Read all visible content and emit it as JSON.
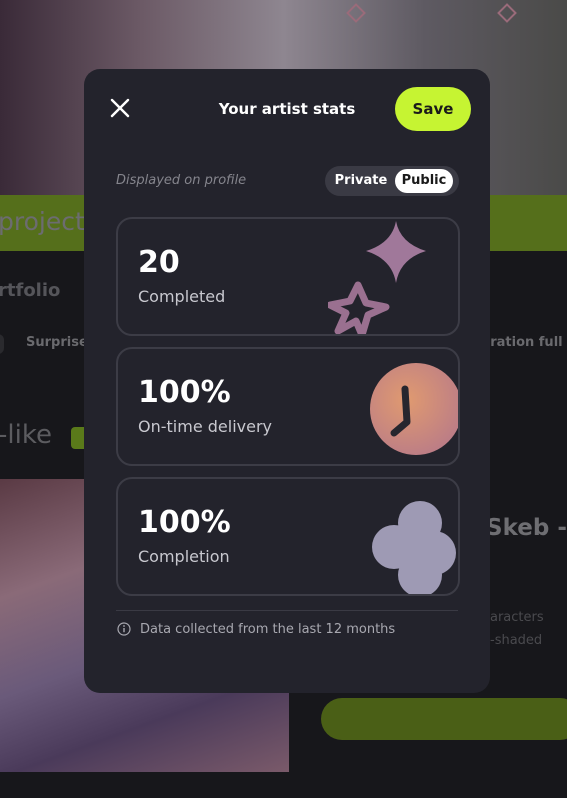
{
  "background": {
    "band_text": "projects",
    "portfolio_text": "rtfolio",
    "surprise_chip": "Surprise",
    "illustration_chip": "tration full c",
    "section_heading": "-like",
    "listing_title": "Skeb - t",
    "characters_text": "aracters",
    "shaded_text": "-shaded"
  },
  "modal": {
    "title": "Your artist stats",
    "close_icon": "close-icon",
    "save_label": "Save",
    "visibility": {
      "label": "Displayed on profile",
      "options": [
        "Private",
        "Public"
      ],
      "selected": "Public"
    },
    "stats": [
      {
        "value": "20",
        "label": "Completed",
        "icon": "star-shapes-icon"
      },
      {
        "value": "100%",
        "label": "On-time delivery",
        "icon": "clock-icon"
      },
      {
        "value": "100%",
        "label": "Completion",
        "icon": "clover-icon"
      }
    ],
    "footer": {
      "icon": "info-icon",
      "text": "Data collected from the last 12 months"
    }
  },
  "colors": {
    "accent": "#c6f432",
    "modal_bg": "#23232c",
    "card_border": "#3c3c46"
  }
}
